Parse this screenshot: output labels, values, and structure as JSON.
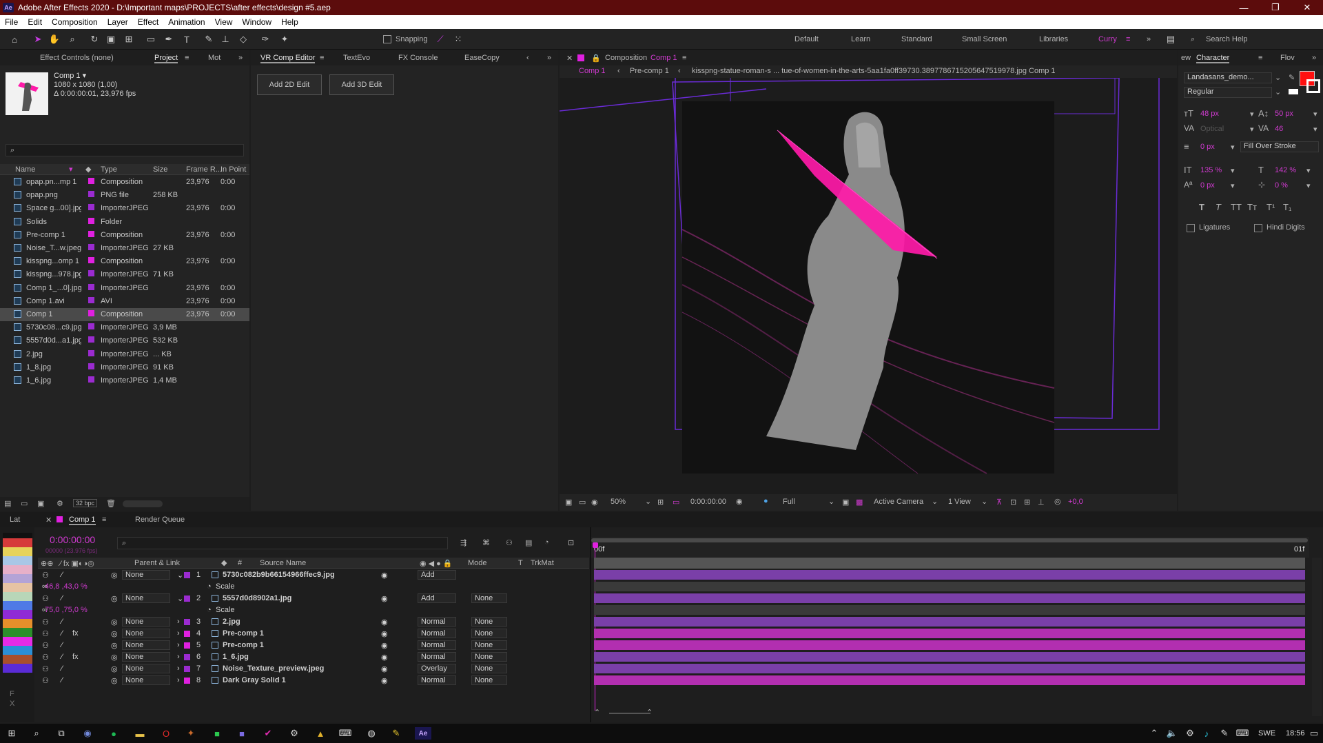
{
  "window": {
    "title": "Adobe After Effects 2020 - D:\\Important maps\\PROJECTS\\after effects\\design #5.aep",
    "app_badge": "Ae",
    "min": "—",
    "max": "❐",
    "close": "✕"
  },
  "menu": [
    "File",
    "Edit",
    "Composition",
    "Layer",
    "Effect",
    "Animation",
    "View",
    "Window",
    "Help"
  ],
  "toolbar": {
    "snapping": "Snapping",
    "workspaces": [
      "Default",
      "Learn",
      "Standard",
      "Small Screen",
      "Libraries",
      "Curry"
    ],
    "search": "Search Help"
  },
  "project_panel": {
    "tabs": [
      "Effect Controls (none)",
      "Project",
      "Mot"
    ],
    "comp_name": "Comp 1 ▾",
    "comp_size": "1080 x 1080 (1,00)",
    "comp_duration": "Δ 0:00:00:01, 23,976 fps",
    "columns": [
      "Name",
      "Type",
      "Size",
      "Frame R...",
      "In Point"
    ],
    "items": [
      {
        "name": "opap.pn...mp 1",
        "type": "Composition",
        "size": "",
        "fps": "23,976",
        "in": "0:00",
        "color": "#e020e0"
      },
      {
        "name": "opap.png",
        "type": "PNG file",
        "size": "258 KB",
        "fps": "",
        "in": "",
        "color": "#9b2bd0"
      },
      {
        "name": "Space g...00].jpg",
        "type": "ImporterJPEG",
        "size": "",
        "fps": "23,976",
        "in": "0:00",
        "color": "#9b2bd0"
      },
      {
        "name": "Solids",
        "type": "Folder",
        "size": "",
        "fps": "",
        "in": "",
        "color": "#e020e0"
      },
      {
        "name": "Pre-comp 1",
        "type": "Composition",
        "size": "",
        "fps": "23,976",
        "in": "0:00",
        "color": "#e020e0"
      },
      {
        "name": "Noise_T...w.jpeg",
        "type": "ImporterJPEG",
        "size": "27 KB",
        "fps": "",
        "in": "",
        "color": "#9b2bd0"
      },
      {
        "name": "kisspng...omp 1",
        "type": "Composition",
        "size": "",
        "fps": "23,976",
        "in": "0:00",
        "color": "#e020e0"
      },
      {
        "name": "kisspng...978.jpg",
        "type": "ImporterJPEG",
        "size": "71 KB",
        "fps": "",
        "in": "",
        "color": "#9b2bd0"
      },
      {
        "name": "Comp 1_...0].jpg",
        "type": "ImporterJPEG",
        "size": "",
        "fps": "23,976",
        "in": "0:00",
        "color": "#9b2bd0"
      },
      {
        "name": "Comp 1.avi",
        "type": "AVI",
        "size": "",
        "fps": "23,976",
        "in": "0:00",
        "color": "#9b2bd0"
      },
      {
        "name": "Comp 1",
        "type": "Composition",
        "size": "",
        "fps": "23,976",
        "in": "0:00",
        "color": "#e020e0"
      },
      {
        "name": "5730c08...c9.jpg",
        "type": "ImporterJPEG",
        "size": "3,9 MB",
        "fps": "",
        "in": "",
        "color": "#9b2bd0"
      },
      {
        "name": "5557d0d...a1.jpg",
        "type": "ImporterJPEG",
        "size": "532 KB",
        "fps": "",
        "in": "",
        "color": "#9b2bd0"
      },
      {
        "name": "2.jpg",
        "type": "ImporterJPEG",
        "size": "... KB",
        "fps": "",
        "in": "",
        "color": "#9b2bd0"
      },
      {
        "name": "1_8.jpg",
        "type": "ImporterJPEG",
        "size": "91 KB",
        "fps": "",
        "in": "",
        "color": "#9b2bd0"
      },
      {
        "name": "1_6.jpg",
        "type": "ImporterJPEG",
        "size": "1,4 MB",
        "fps": "",
        "in": "",
        "color": "#9b2bd0"
      }
    ],
    "bpc": "32 bpc"
  },
  "vr_panel": {
    "tabs": [
      "VR Comp Editor",
      "TextEvo",
      "FX Console",
      "EaseCopy"
    ],
    "add2d": "Add 2D Edit",
    "add3d": "Add 3D Edit"
  },
  "comp_panel": {
    "tab_prefix": "Composition",
    "tab_name": "Comp 1",
    "breadcrumb": [
      "Comp 1",
      "Pre-comp 1",
      "kisspng-statue-roman-s ... tue-of-women-in-the-arts-5aa1fa0ff39730.3897786715205647519978.jpg Comp 1"
    ],
    "zoom": "50%",
    "timecode": "0:00:00:00",
    "resolution": "Full",
    "camera": "Active Camera",
    "views": "1 View",
    "exposure": "+0,0"
  },
  "character_panel": {
    "tabs": [
      "ew",
      "Character",
      "Flov"
    ],
    "font": "Landasans_demo...",
    "style": "Regular",
    "size": "48 px",
    "leading": "50 px",
    "kerning": "Optical",
    "tracking": "46",
    "stroke_width": "0 px",
    "stroke_type": "Fill Over Stroke",
    "vscale": "135 %",
    "hscale": "142 %",
    "baseline": "0 px",
    "tsume": "0 %",
    "ligatures": "Ligatures",
    "hindi": "Hindi Digits",
    "fill_color": "#ff1010"
  },
  "timeline": {
    "tabs": [
      "Lat",
      "Comp 1",
      "Render Queue"
    ],
    "timecode": "0:00:00:00",
    "fps_sub": "00000 (23.976 fps)",
    "headers": {
      "parent": "Parent & Link",
      "num": "#",
      "source": "Source Name",
      "mode": "Mode",
      "t": "T",
      "trkmat": "TrkMat"
    },
    "ruler_start": "00f",
    "ruler_end": "01f",
    "layers": [
      {
        "num": "1",
        "name": "5730c082b9b66154966ffec9.jpg",
        "parent": "None",
        "mode": "Add",
        "trkmat": "",
        "color": "#9b2bd0",
        "bar": "#7a3fa8",
        "fx": ""
      },
      {
        "num": "2",
        "name": "5557d0d8902a1.jpg",
        "parent": "None",
        "mode": "Add",
        "trkmat": "None",
        "color": "#9b2bd0",
        "bar": "#7a3fa8",
        "fx": ""
      },
      {
        "num": "3",
        "name": "2.jpg",
        "parent": "None",
        "mode": "Normal",
        "trkmat": "None",
        "color": "#9b2bd0",
        "bar": "#7a3fa8",
        "fx": ""
      },
      {
        "num": "4",
        "name": "Pre-comp 1",
        "parent": "None",
        "mode": "Normal",
        "trkmat": "None",
        "color": "#e020e0",
        "bar": "#b22fb0",
        "fx": "fx"
      },
      {
        "num": "5",
        "name": "Pre-comp 1",
        "parent": "None",
        "mode": "Normal",
        "trkmat": "None",
        "color": "#e020e0",
        "bar": "#b22fb0",
        "fx": ""
      },
      {
        "num": "6",
        "name": "1_6.jpg",
        "parent": "None",
        "mode": "Normal",
        "trkmat": "None",
        "color": "#9b2bd0",
        "bar": "#7a3fa8",
        "fx": "fx"
      },
      {
        "num": "7",
        "name": "Noise_Texture_preview.jpeg",
        "parent": "None",
        "mode": "Overlay",
        "trkmat": "None",
        "color": "#9b2bd0",
        "bar": "#7a3fa8",
        "fx": ""
      },
      {
        "num": "8",
        "name": "Dark Gray Solid 1",
        "parent": "None",
        "mode": "Normal",
        "trkmat": "None",
        "color": "#e020e0",
        "bar": "#b22fb0",
        "fx": ""
      }
    ],
    "scale1_label": "Scale",
    "scale1_value": "46,8 ,43,0 %",
    "scale2_label": "Scale",
    "scale2_value": "75,0 ,75,0 %"
  },
  "swatches": [
    "#d63a3a",
    "#e6d35a",
    "#a8c7e6",
    "#e6b0c8",
    "#b3a3d6",
    "#e6c3a3",
    "#b8d6b8",
    "#4f7ae6",
    "#8f2bd6",
    "#e68f2b",
    "#2b8f2b",
    "#e62be6",
    "#2b8fd6",
    "#a84f2b",
    "#5a2bd6"
  ],
  "taskbar": {
    "lang": "SWE",
    "time": "18:56"
  }
}
